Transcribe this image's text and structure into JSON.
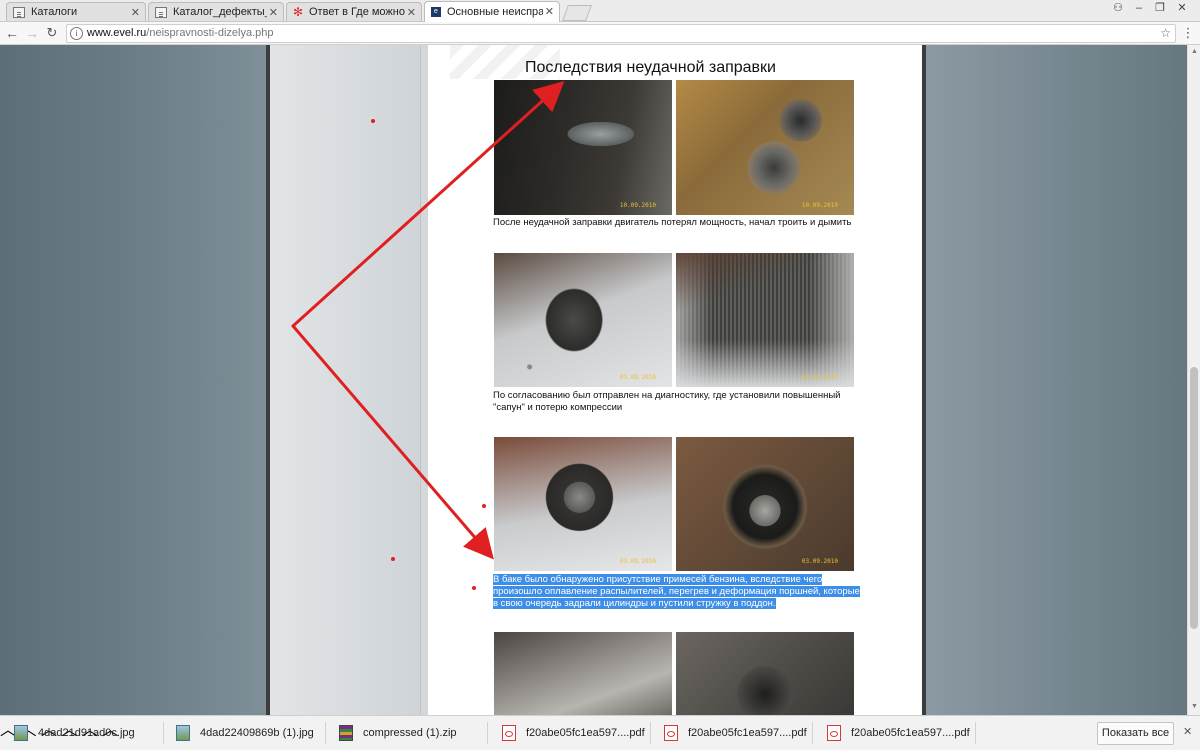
{
  "browser": {
    "tabs": [
      {
        "title": "Каталоги",
        "icon": "document-icon"
      },
      {
        "title": "Каталог_дефекты_в_печ",
        "icon": "document-icon"
      },
      {
        "title": "Ответ в Где можно сде",
        "icon": "forum-flower-icon"
      },
      {
        "title": "Основные неисправнос",
        "icon": "evel-site-icon"
      }
    ],
    "url_host": "www.evel.ru",
    "url_path": "/neispravnosti-dizelya.php"
  },
  "page": {
    "title": "Последствия неудачной заправки",
    "captions": [
      "После неудачной заправки двигатель потерял мощность, начал троить и дымить",
      "По согласованию был отправлен на диагностику, где установили повышенный \"сапун\" и потерю компрессии",
      "В баке было обнаружено присутствие примесей бензина, вследствие чего произошло оплавление распылителей, перегрев и деформация поршней, которые в свою очередь задрали цилиндры и пустили стружку в поддон."
    ],
    "photo_timestamps": [
      "10.09.2010",
      "10.09.2010",
      "03.09.2010",
      "03.09.2010",
      "03.09.2010",
      "03.09.2010"
    ]
  },
  "downloads": {
    "items": [
      {
        "name": "4dad21d91ad0c.jpg",
        "type": "image-file-icon"
      },
      {
        "name": "4dad22409869b (1).jpg",
        "type": "image-file-icon"
      },
      {
        "name": "compressed (1).zip",
        "type": "zip-archive-icon"
      },
      {
        "name": "f20abe05fc1ea597....pdf",
        "type": "pdf-file-icon"
      },
      {
        "name": "f20abe05fc1ea597....pdf",
        "type": "pdf-file-icon"
      },
      {
        "name": "f20abe05fc1ea597....pdf",
        "type": "pdf-file-icon"
      }
    ],
    "show_all_label": "Показать все"
  },
  "colors": {
    "selection": "#3d8ee8",
    "annotation_red": "#e02020"
  }
}
